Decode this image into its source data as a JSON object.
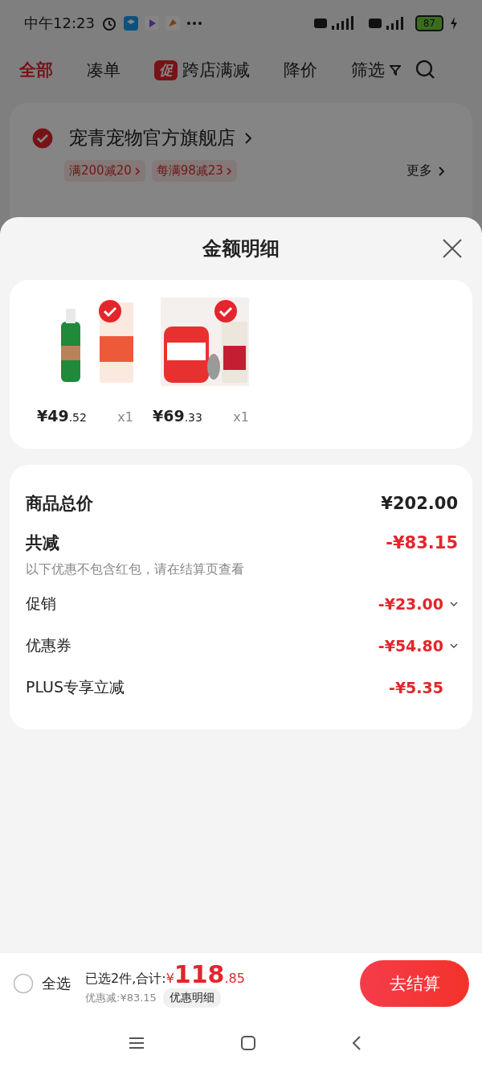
{
  "status_bar": {
    "time": "中午12:23",
    "battery": "87"
  },
  "tabs": [
    {
      "label": "全部",
      "selected": true
    },
    {
      "label": "凑单",
      "selected": false
    },
    {
      "label": "跨店满减",
      "badge": "促",
      "selected": false
    },
    {
      "label": "降价",
      "selected": false
    },
    {
      "label": "筛选",
      "selected": false,
      "kind": "filter"
    }
  ],
  "store": {
    "name": "宠青宠物官方旗舰店",
    "checked": true,
    "promos": [
      "满200减20",
      "每满98减23"
    ],
    "more": "更多"
  },
  "sheet": {
    "title": "金额明细",
    "products": [
      {
        "kind": "picture",
        "price_int": "¥49",
        "price_dec": ".52",
        "qty": "x1",
        "checked": true
      },
      {
        "kind": "picture",
        "price_int": "¥69",
        "price_dec": ".33",
        "qty": "x1",
        "checked": true
      }
    ],
    "rows": [
      {
        "kind": "total",
        "label": "商品总价",
        "value": "¥202.00"
      },
      {
        "kind": "reduce",
        "label": "共减",
        "value": "-¥83.15",
        "note": "以下优惠不包含红包，请在结算页查看"
      },
      {
        "kind": "detail",
        "label": "促销",
        "value": "-¥23.00",
        "expandable": true
      },
      {
        "kind": "detail",
        "label": "优惠券",
        "value": "-¥54.80",
        "expandable": true
      },
      {
        "kind": "detail",
        "label": "PLUS专享立减",
        "value": "-¥5.35",
        "expandable": false
      }
    ]
  },
  "footer": {
    "select_all": {
      "label": "全选",
      "checked": false
    },
    "summary": "已选2件,合计:",
    "currency": "¥",
    "total_int": "118",
    "total_dec": ".85",
    "discount": "优惠减:¥83.15",
    "detail_button": "优惠明细",
    "checkout": "去结算"
  }
}
